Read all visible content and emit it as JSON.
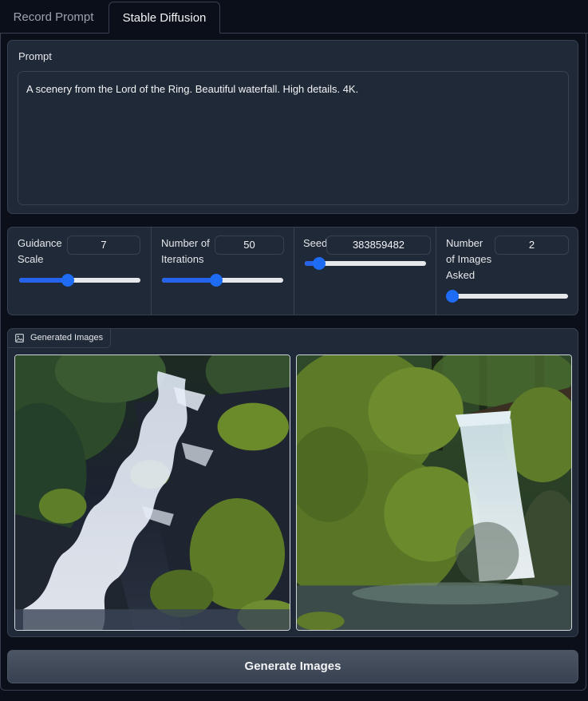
{
  "tabs": [
    {
      "label": "Record Prompt",
      "active": false
    },
    {
      "label": "Stable Diffusion",
      "active": true
    }
  ],
  "prompt": {
    "label": "Prompt",
    "value": "A scenery from the Lord of the Ring. Beautiful waterfall. High details. 4K."
  },
  "sliders": {
    "guidance": {
      "label_line1": "Guidance",
      "label_line2": "Scale",
      "value": "7",
      "fill_fraction": 0.4
    },
    "iterations": {
      "label_line1": "Number of",
      "label_line2": "Iterations",
      "value": "50",
      "fill_fraction": 0.45
    },
    "seed": {
      "label_line1": "Seed",
      "value": "383859482",
      "fill_fraction": 0.12
    },
    "num_images": {
      "label_line1": "Number",
      "label_line2": "of Images",
      "label_line3": "Asked",
      "value": "2",
      "fill_fraction": 0.0
    }
  },
  "gallery": {
    "label": "Generated Images",
    "icon": "image-icon",
    "images": [
      {
        "name": "generated-image-1",
        "subject": "cascading waterfall over mossy rocks"
      },
      {
        "name": "generated-image-2",
        "subject": "waterfall beside mossy boulders in forest"
      }
    ]
  },
  "generate_button": {
    "label": "Generate Images"
  },
  "colors": {
    "background": "#0b0f19",
    "panel": "#1f2937",
    "border": "#374151",
    "accent": "#1d6cf3"
  }
}
